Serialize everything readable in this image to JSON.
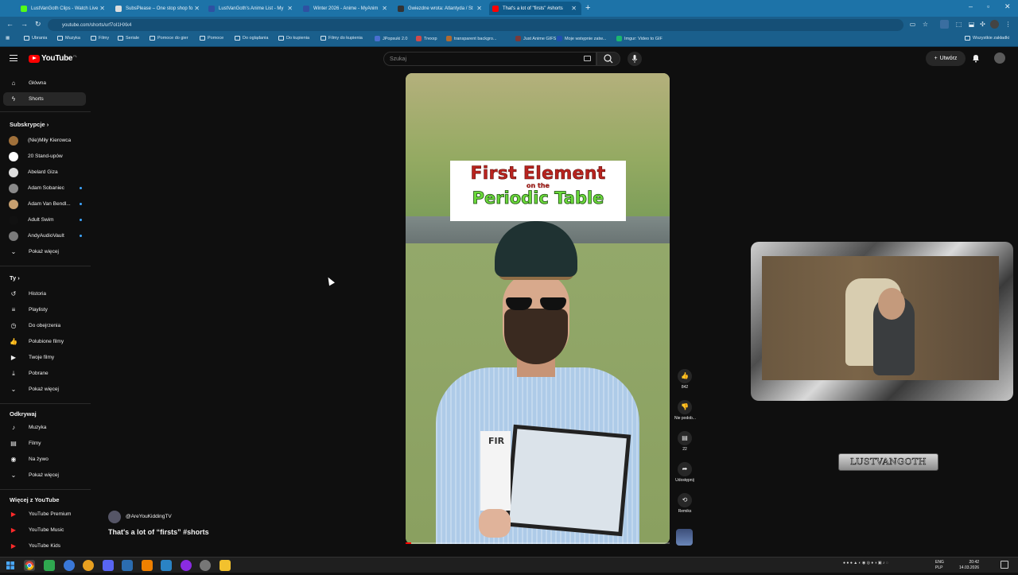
{
  "browser": {
    "tabs": [
      {
        "label": "LustVanGoth Clips - Watch Live",
        "color": "#53fc18",
        "active": false
      },
      {
        "label": "SubsPlease – One stop shop fo",
        "color": "#dddddd",
        "active": false
      },
      {
        "label": "LustVanGoth's Anime List - My",
        "color": "#2e51a2",
        "active": false
      },
      {
        "label": "Winter 2026 - Anime - MyAnim",
        "color": "#2e51a2",
        "active": false
      },
      {
        "label": "Gwiezdne wrota: Atlantyda / St",
        "color": "#333333",
        "active": false
      },
      {
        "label": "That's a lot of \"firsts\" #shorts",
        "color": "#ff0000",
        "active": true
      }
    ],
    "url": "youtube.com/shorts/urf7oI1HXk4",
    "bookmarks": [
      {
        "label": "Ubrania",
        "type": "folder"
      },
      {
        "label": "Muzyka",
        "type": "folder"
      },
      {
        "label": "Filmy",
        "type": "folder"
      },
      {
        "label": "Seriale",
        "type": "folder"
      },
      {
        "label": "Pomoce do gier",
        "type": "folder"
      },
      {
        "label": "Pomoce",
        "type": "folder"
      },
      {
        "label": "Do oglądania",
        "type": "folder"
      },
      {
        "label": "Do kupienia",
        "type": "folder"
      },
      {
        "label": "Filmy do kupienia",
        "type": "folder"
      },
      {
        "label": "JPopsuki 2.0",
        "type": "site",
        "color": "#4a6fd0"
      },
      {
        "label": "Trexxp",
        "type": "site",
        "color": "#d04a4a"
      },
      {
        "label": "transparent backgro...",
        "type": "site",
        "color": "#b06a30"
      },
      {
        "label": "Just Anime GIFS",
        "type": "site",
        "color": "#7a3a3a"
      },
      {
        "label": "Moje wstępnie zatw...",
        "type": "site",
        "color": "#1f4fb0"
      },
      {
        "label": "Imgur: Video to GIF",
        "type": "site",
        "color": "#1bb76e"
      }
    ],
    "all_bookmarks_label": "Wszystkie zakładki"
  },
  "youtube": {
    "logo_text": "YouTube",
    "region": "PL",
    "search_placeholder": "Szukaj",
    "create_label": "Utwórz",
    "sidebar": {
      "main": [
        {
          "label": "Główna",
          "icon": "home-icon"
        },
        {
          "label": "Shorts",
          "icon": "shorts-icon",
          "active": true
        }
      ],
      "subscriptions_heading": "Subskrypcje",
      "subscriptions": [
        {
          "label": "(Nie)Miły Kierowca",
          "color": "#a0703a",
          "dot": false
        },
        {
          "label": "20 Stand-upów",
          "color": "#ffffff",
          "dot": false
        },
        {
          "label": "Abelard Giza",
          "color": "#dddddd",
          "dot": false
        },
        {
          "label": "Adam Sobaniec",
          "color": "#8a8a8a",
          "dot": true
        },
        {
          "label": "Adam Van Bendl...",
          "color": "#c8a070",
          "dot": true
        },
        {
          "label": "Adult Swim",
          "color": "#111111",
          "dot": true
        },
        {
          "label": "AndyAudioVault",
          "color": "#7a7a7a",
          "dot": true
        }
      ],
      "show_more_1": "Pokaż więcej",
      "you_heading": "Ty",
      "you_items": [
        {
          "label": "Historia",
          "icon": "history-icon"
        },
        {
          "label": "Playlisty",
          "icon": "playlist-icon"
        },
        {
          "label": "Do obejrzenia",
          "icon": "watch-later-icon"
        },
        {
          "label": "Polubione filmy",
          "icon": "like-icon"
        },
        {
          "label": "Twoje filmy",
          "icon": "your-videos-icon"
        },
        {
          "label": "Pobrane",
          "icon": "download-icon"
        }
      ],
      "show_more_2": "Pokaż więcej",
      "explore_heading": "Odkrywaj",
      "explore_items": [
        {
          "label": "Muzyka",
          "icon": "music-icon"
        },
        {
          "label": "Filmy",
          "icon": "movies-icon"
        },
        {
          "label": "Na żywo",
          "icon": "live-icon"
        }
      ],
      "show_more_3": "Pokaż więcej",
      "more_heading": "Więcej z YouTube",
      "more_items": [
        {
          "label": "YouTube Premium"
        },
        {
          "label": "YouTube Music"
        },
        {
          "label": "YouTube Kids"
        }
      ]
    },
    "short": {
      "caption_line1": "First Element",
      "caption_line2": "on the",
      "caption_line3": "Periodic Table",
      "board_text": "FIR",
      "channel": "@AreYouKiddingTV",
      "title": "That's a lot of “firsts” #shorts",
      "progress_fraction": 0.02,
      "actions": [
        {
          "label": "842",
          "icon": "thumbs-up-icon"
        },
        {
          "label": "Nie podob...",
          "icon": "thumbs-down-icon"
        },
        {
          "label": "22",
          "icon": "comment-icon"
        },
        {
          "label": "Udostępnij",
          "icon": "share-icon"
        },
        {
          "label": "Remiks",
          "icon": "remix-icon"
        }
      ]
    }
  },
  "overlay": {
    "webcam_name": "LUSTVANGOTH"
  },
  "taskbar": {
    "lang_line1": "ENG",
    "lang_line2": "PLP",
    "time": "20:42",
    "date": "14.03.2026"
  }
}
